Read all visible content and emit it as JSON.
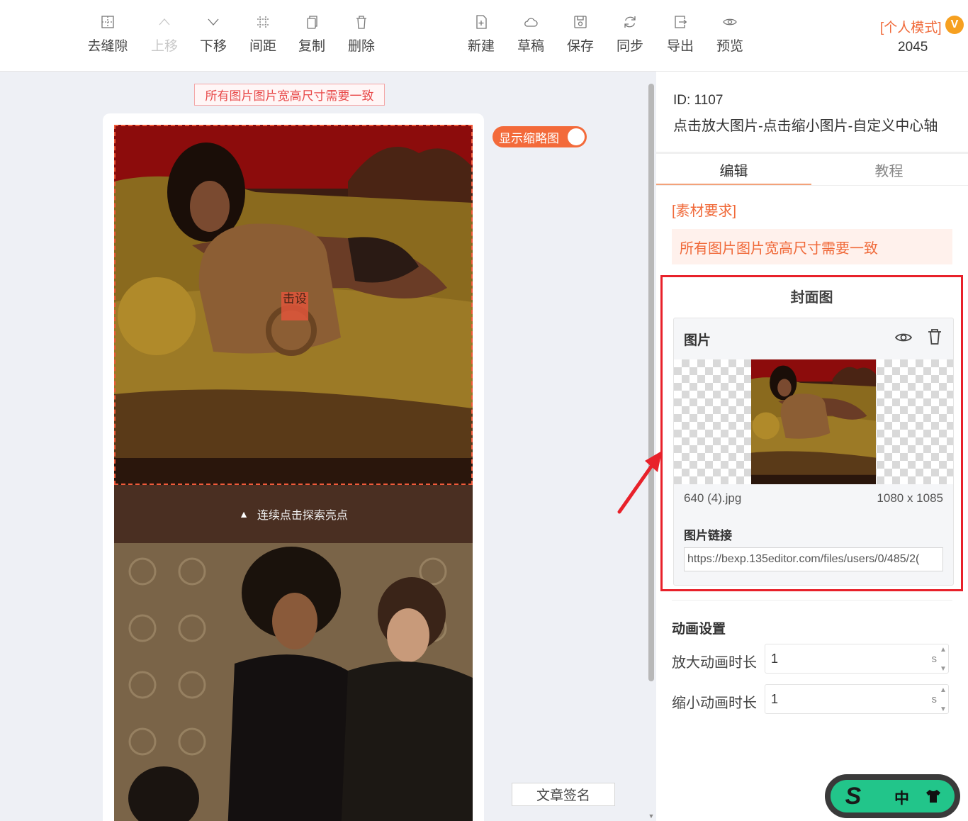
{
  "toolbar": {
    "left_tools": [
      {
        "id": "remove-gap",
        "label": "去缝隙",
        "icon": "grid-square-icon",
        "disabled": false
      },
      {
        "id": "move-up",
        "label": "上移",
        "icon": "chevron-up-icon",
        "disabled": true
      },
      {
        "id": "move-down",
        "label": "下移",
        "icon": "chevron-down-icon",
        "disabled": false
      },
      {
        "id": "spacing",
        "label": "间距",
        "icon": "spacing-grid-icon",
        "disabled": false
      },
      {
        "id": "copy",
        "label": "复制",
        "icon": "copy-icon",
        "disabled": false
      },
      {
        "id": "delete",
        "label": "删除",
        "icon": "trash-icon",
        "disabled": false
      }
    ],
    "right_tools": [
      {
        "id": "new",
        "label": "新建",
        "icon": "new-file-icon"
      },
      {
        "id": "draft",
        "label": "草稿",
        "icon": "cloud-icon"
      },
      {
        "id": "save",
        "label": "保存",
        "icon": "floppy-icon"
      },
      {
        "id": "sync",
        "label": "同步",
        "icon": "sync-icon"
      },
      {
        "id": "export",
        "label": "导出",
        "icon": "export-icon"
      },
      {
        "id": "preview",
        "label": "预览",
        "icon": "eye-icon"
      }
    ],
    "mode_label": "[个人模式]",
    "mode_badge": "V",
    "mode_count": "2045"
  },
  "canvas": {
    "tip": "所有图片图片宽高尺寸需要一致",
    "click_hint": "击设",
    "band_icon": "▲",
    "band_text": "连续点击探索亮点",
    "thumbnail_toggle_label": "显示缩略图",
    "thumbnail_toggle_on": true,
    "signature_button": "文章签名"
  },
  "panel": {
    "id_text": "ID: 1107",
    "name": "点击放大图片-点击缩小图片-自定义中心轴",
    "tabs": [
      {
        "label": "编辑",
        "active": true
      },
      {
        "label": "教程",
        "active": false
      }
    ],
    "requirement_title": "[素材要求]",
    "requirement_text": "所有图片图片宽高尺寸需要一致",
    "cover": {
      "title": "封面图",
      "image_label": "图片",
      "file_name": "640 (4).jpg",
      "dimensions": "1080 x 1085",
      "link_label": "图片链接",
      "link_value": "https://bexp.135editor.com/files/users/0/485/2("
    },
    "animation": {
      "title": "动画设置",
      "zoom_in_label": "放大动画时长",
      "zoom_in_value": "1",
      "zoom_out_label": "缩小动画时长",
      "zoom_out_value": "1",
      "unit": "s"
    }
  },
  "floating_widget": {
    "logo": "S",
    "lang": "中"
  },
  "colors": {
    "accent": "#f06a3a",
    "highlight_border": "#e8212a",
    "widget_green": "#22c58a"
  }
}
